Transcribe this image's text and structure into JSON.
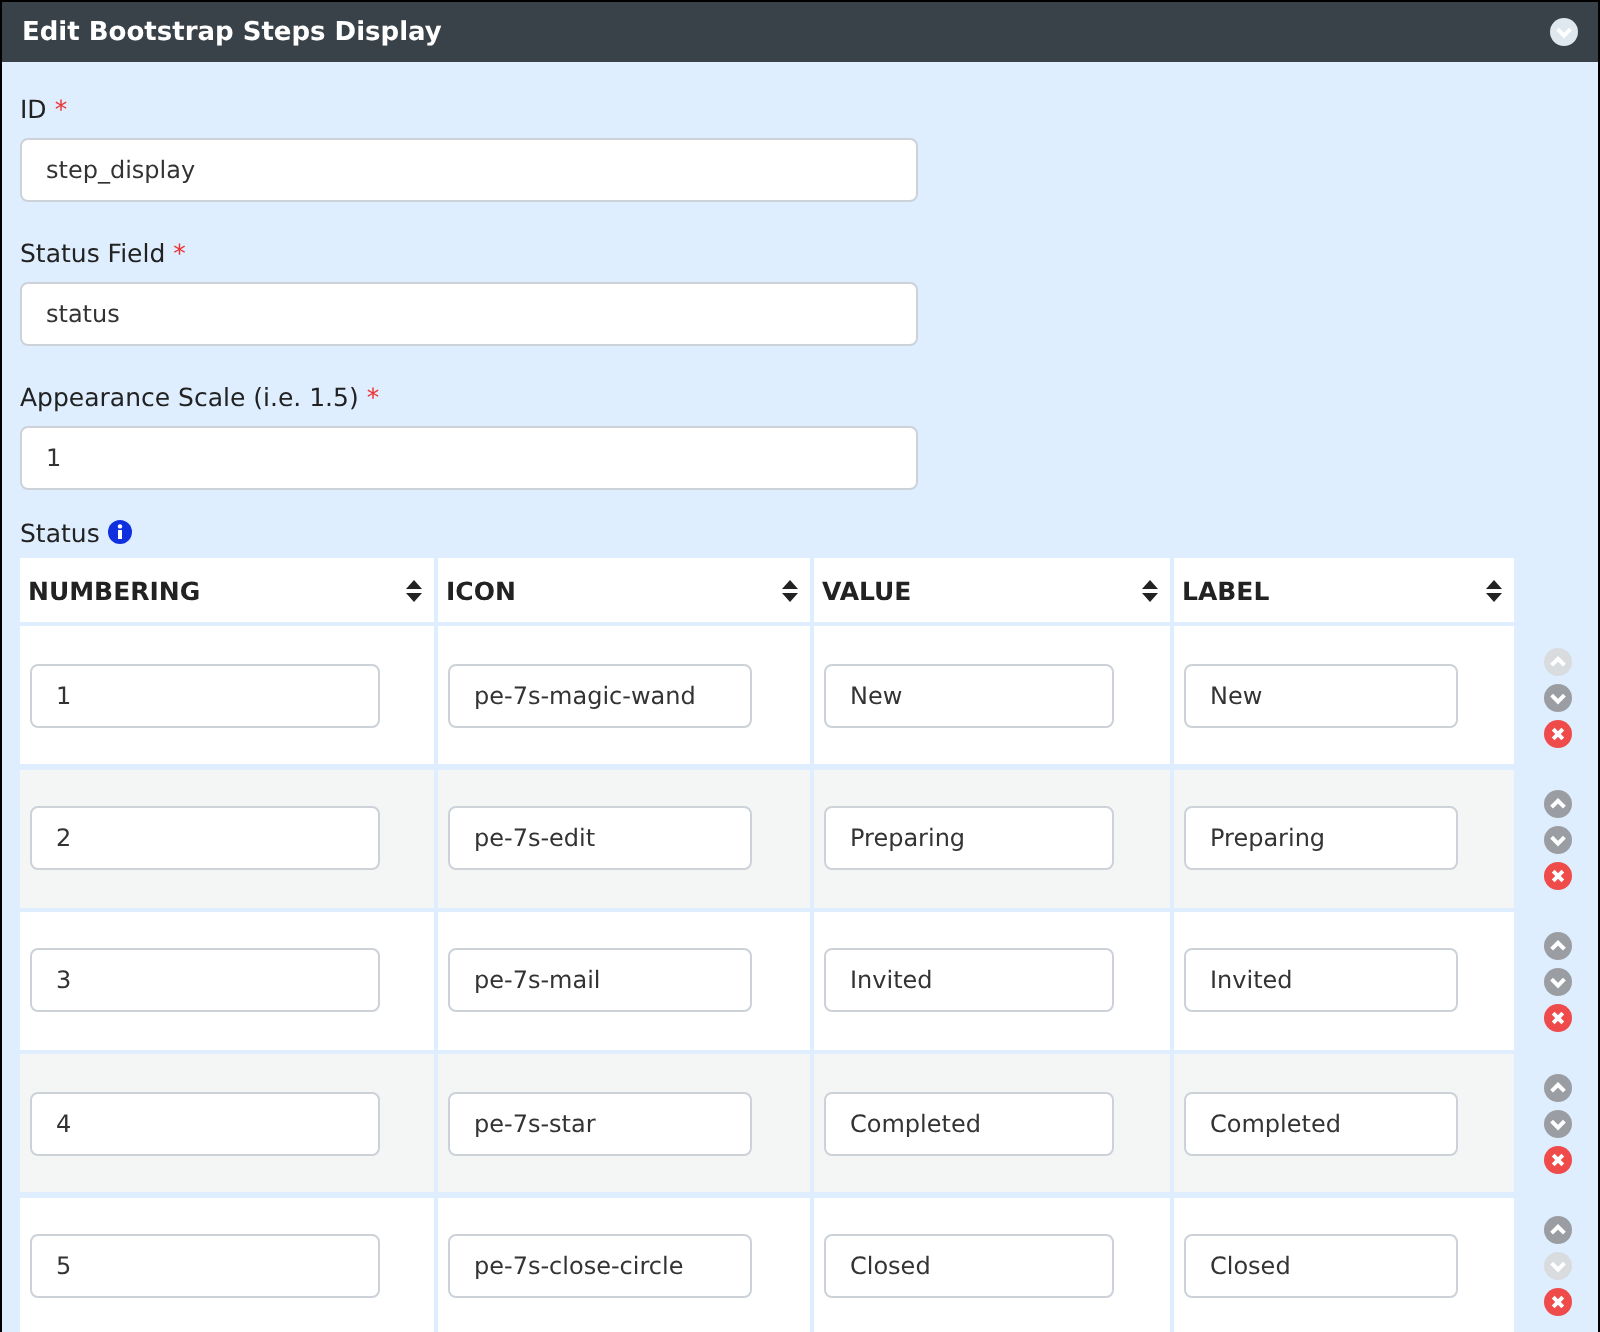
{
  "panel": {
    "title": "Edit Bootstrap Steps Display"
  },
  "fields": [
    {
      "label": "ID",
      "required_mark": "*",
      "value": "step_display"
    },
    {
      "label": "Status Field",
      "required_mark": "*",
      "value": "status"
    },
    {
      "label": "Appearance Scale (i.e. 1.5)",
      "required_mark": "*",
      "value": "1"
    }
  ],
  "status_table": {
    "label": "Status",
    "columns": [
      "NUMBERING",
      "ICON",
      "VALUE",
      "LABEL"
    ],
    "rows": [
      {
        "cells": [
          "1",
          "pe-7s-magic-wand",
          "New",
          "New"
        ],
        "up_disabled": true,
        "down_disabled": false
      },
      {
        "cells": [
          "2",
          "pe-7s-edit",
          "Preparing",
          "Preparing"
        ],
        "up_disabled": false,
        "down_disabled": false
      },
      {
        "cells": [
          "3",
          "pe-7s-mail",
          "Invited",
          "Invited"
        ],
        "up_disabled": false,
        "down_disabled": false
      },
      {
        "cells": [
          "4",
          "pe-7s-star",
          "Completed",
          "Completed"
        ],
        "up_disabled": false,
        "down_disabled": false
      },
      {
        "cells": [
          "5",
          "pe-7s-close-circle",
          "Closed",
          "Closed"
        ],
        "up_disabled": false,
        "down_disabled": true
      }
    ]
  }
}
